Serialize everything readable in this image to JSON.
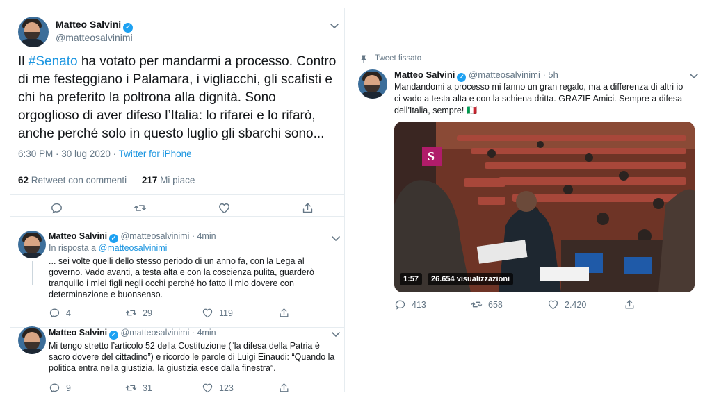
{
  "main_tweet": {
    "author": "Matteo Salvini",
    "handle": "@matteosalvinimi",
    "text_pre": "Il ",
    "hashtag": "#Senato",
    "text_post": " ha votato per mandarmi a processo. Contro di me festeggiano i Palamara, i vigliacchi, gli scafisti e chi ha preferito la poltrona alla dignità. Sono orgoglioso di aver difeso l’Italia: lo rifarei e lo rifarò, anche perché solo in questo luglio gli sbarchi sono...",
    "timestamp": "6:30 PM · 30 lug 2020",
    "separator": " · ",
    "source": "Twitter for iPhone",
    "retweets_count": "62",
    "retweets_label": "Retweet con commenti",
    "likes_count": "217",
    "likes_label": "Mi piace"
  },
  "replies": [
    {
      "author": "Matteo Salvini",
      "handle": "@matteosalvinimi",
      "time": "· 4min",
      "reply_to_label": "In risposta a",
      "reply_to_handle": "@matteosalvinimi",
      "text": "... sei volte quelli dello stesso periodo di un anno fa, con la Lega al governo. Vado avanti, a testa alta e con la coscienza pulita, guarderò tranquillo i miei figli negli occhi perché ho fatto il mio dovere con determinazione e buonsenso.",
      "replies_count": "4",
      "retweets_count": "29",
      "likes_count": "119"
    },
    {
      "author": "Matteo Salvini",
      "handle": "@matteosalvinimi",
      "time": "· 4min",
      "text": "Mi tengo stretto l’articolo 52 della Costituzione (“la difesa della Patria è sacro dovere del cittadino”) e ricordo le parole di Luigi Einaudi: “Quando la politica entra nella giustizia, la giustizia esce dalla finestra”.",
      "replies_count": "9",
      "retweets_count": "31",
      "likes_count": "123"
    }
  ],
  "pinned_tweet": {
    "pin_label": "Tweet fissato",
    "author": "Matteo Salvini",
    "handle": "@matteosalvinimi",
    "time": "· 5h",
    "text": "Mandandomi a processo mi fanno un gran regalo, ma a differenza di altri io ci vado a testa alta e con la schiena dritta. GRAZIE Amici. Sempre a difesa dell'Italia, sempre! 🇮🇹",
    "video_duration": "1:57",
    "video_views": "26.654 visualizzazioni",
    "replies_count": "413",
    "retweets_count": "658",
    "likes_count": "2.420"
  },
  "icons": [
    "reply-icon",
    "retweet-icon",
    "like-icon",
    "share-icon",
    "chevron-down-icon",
    "verified-icon",
    "pin-icon"
  ],
  "colors": {
    "accent": "#1da1f2",
    "link": "#1b95e0",
    "muted": "#657786",
    "text": "#14171a",
    "divider": "#e6ecf0"
  }
}
